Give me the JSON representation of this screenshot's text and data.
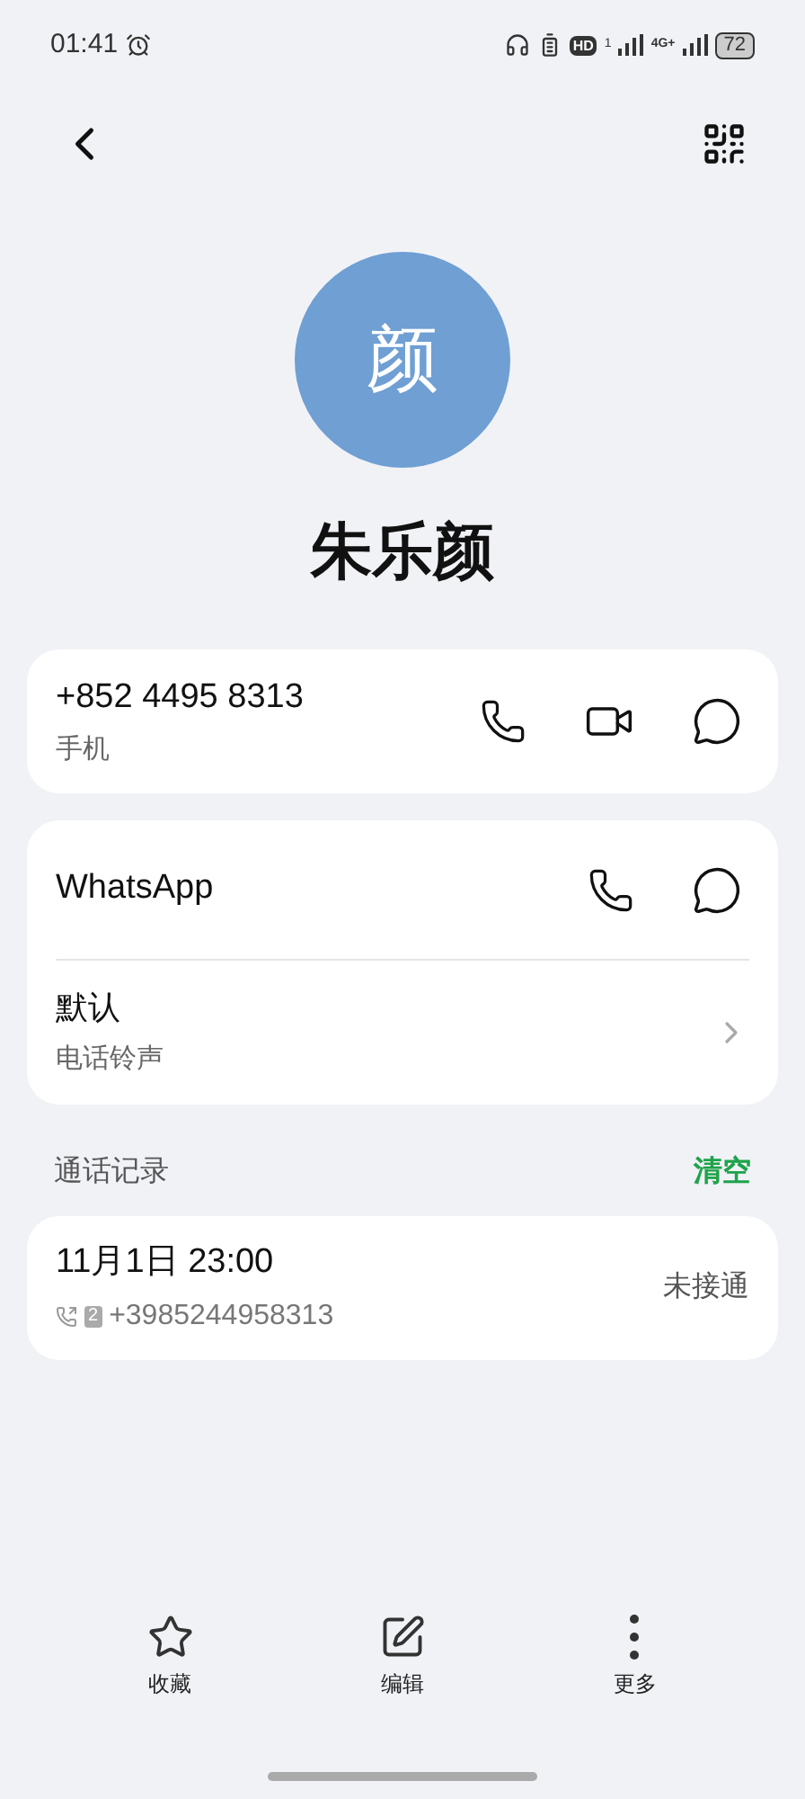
{
  "status_bar": {
    "time": "01:41",
    "hd": "HD",
    "hd_sim": "1",
    "network": "4G+",
    "battery": "72"
  },
  "contact": {
    "avatar_letter": "颜",
    "name": "朱乐颜"
  },
  "phone": {
    "number": "+852 4495 8313",
    "label": "手机"
  },
  "whatsapp": {
    "label": "WhatsApp"
  },
  "ringtone": {
    "value": "默认",
    "label": "电话铃声"
  },
  "call_log": {
    "title": "通话记录",
    "clear": "清空",
    "entries": [
      {
        "time": "11月1日 23:00",
        "sim": "2",
        "number": "+3985244958313",
        "status": "未接通"
      }
    ]
  },
  "bottom_bar": [
    {
      "kind": "star",
      "label": "收藏"
    },
    {
      "kind": "edit",
      "label": "编辑"
    },
    {
      "kind": "more",
      "label": "更多"
    }
  ]
}
